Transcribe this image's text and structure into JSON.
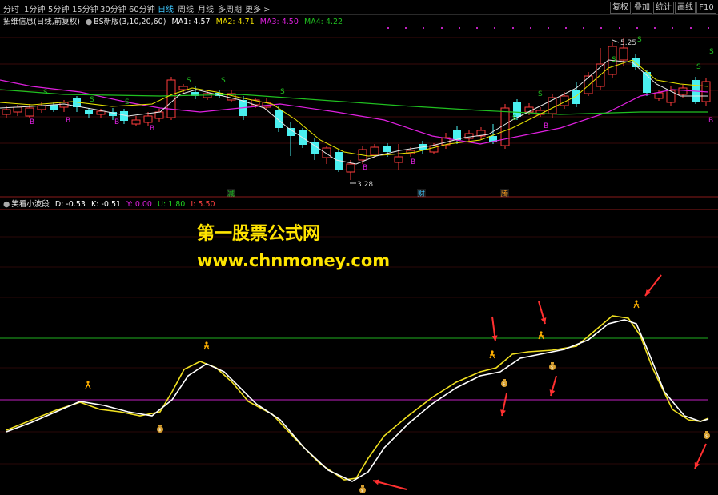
{
  "toolbar": {
    "periods": [
      "分时",
      "1分钟",
      "5分钟",
      "15分钟",
      "30分钟",
      "60分钟",
      "日线",
      "周线",
      "月线",
      "多周期",
      "更多 >"
    ],
    "active": "日线",
    "right_buttons": [
      "复权",
      "叠加",
      "统计",
      "画线",
      "F10"
    ]
  },
  "main": {
    "stock_name": "拓维信息(日线,前复权)",
    "indicator": "BS新版(3,10,20,60)",
    "ma1": "MA1: 4.57",
    "ma2": "MA2: 4.71",
    "ma3": "MA3: 4.50",
    "ma4": "MA4: 4.22",
    "high_label": "5.25",
    "low_label": "3.28",
    "markers": [
      "减",
      "财",
      "腾"
    ],
    "signal_s": "S",
    "signal_b": "B"
  },
  "sub": {
    "indicator": "笑看小波段",
    "d": "D: -0.53",
    "k": "K: -0.51",
    "y": "Y: 0.00",
    "u": "U: 1.80",
    "i": "I: 5.50"
  },
  "watermark": {
    "title": "第一股票公式网",
    "url": "www.chnmoney.com"
  },
  "colors": {
    "up": "#ff3c3c",
    "down": "#4af0f0",
    "ma1": "#e8e8e8",
    "ma2": "#e8e400",
    "ma3": "#e020e0",
    "ma4": "#20c020",
    "k_line": "#f0e020",
    "d_line": "#ffffff",
    "upper_band": "#20b020",
    "lower_band": "#c020c0",
    "arrow": "#ff3030"
  }
}
